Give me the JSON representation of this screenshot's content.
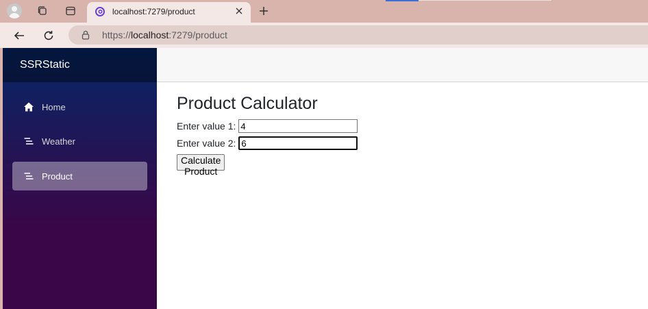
{
  "browser": {
    "tab_title": "localhost:7279/product",
    "url_scheme": "https://",
    "url_host": "localhost",
    "url_rest": ":7279/product"
  },
  "app": {
    "brand": "SSRStatic",
    "nav": [
      {
        "label": "Home",
        "icon": "home-icon",
        "active": false
      },
      {
        "label": "Weather",
        "icon": "list-icon",
        "active": false
      },
      {
        "label": "Product",
        "icon": "list-icon",
        "active": true
      }
    ]
  },
  "page": {
    "title": "Product Calculator",
    "field1": {
      "label": "Enter value 1:",
      "value": "4"
    },
    "field2": {
      "label": "Enter value 2:",
      "value": "6"
    },
    "button_label": "Calculate Product"
  },
  "colors": {
    "sidebar_top": "#052767",
    "sidebar_bottom": "#3a0647",
    "browser_frame": "#d9b4ac",
    "active_nav": "rgba(255,255,255,0.37)"
  }
}
